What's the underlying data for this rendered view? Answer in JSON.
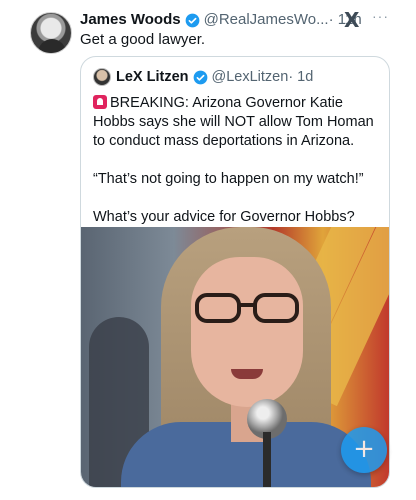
{
  "post": {
    "author_name": "James Woods",
    "author_handle": "@RealJamesWo...",
    "time": "· 11h",
    "x_logo": "X",
    "more": "···",
    "text": "Get a good lawyer."
  },
  "quote": {
    "author_name": "LeX Litzen",
    "author_handle": "@LexLitzen",
    "time": "· 1d",
    "paragraphs": [
      "BREAKING: Arizona Governor Katie Hobbs says she will NOT allow Tom Homan to conduct mass deportations in Arizona.",
      "“That’s not going to happen on my watch!”",
      "What’s your advice for Governor Hobbs?"
    ]
  },
  "compose_button": {
    "label": "+"
  },
  "colors": {
    "verified": "#1d9bf0",
    "accent": "#1d9bf0",
    "text": "#0f1419",
    "muted": "#536471"
  }
}
